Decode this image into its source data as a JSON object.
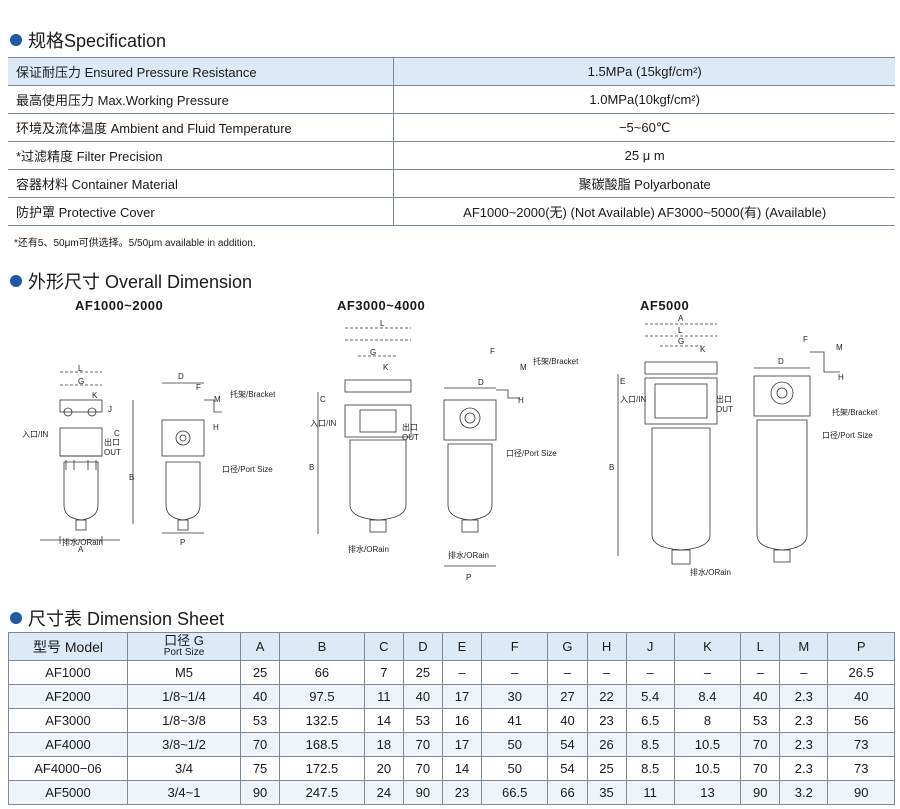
{
  "spec_section": {
    "title": "规格Specification",
    "rows": [
      {
        "label": "保证耐压力 Ensured Pressure Resistance",
        "value": "1.5MPa (15kgf/cm²)"
      },
      {
        "label": "最高使用压力 Max.Working Pressure",
        "value": "1.0MPa(10kgf/cm²)"
      },
      {
        "label": "环境及流体温度 Ambient and Fluid Temperature",
        "value": "−5~60℃"
      },
      {
        "label": "*过滤精度 Filter Precision",
        "value": "25 μ m"
      },
      {
        "label": "容器材料 Container Material",
        "value": "聚碳酸脂 Polyarbonate"
      },
      {
        "label": "防护罩 Protective Cover",
        "value": "AF1000~2000(无) (Not Available)  AF3000~5000(有) (Available)"
      }
    ],
    "note": "*还有5、50μm可供选择。5/50μm available in addition."
  },
  "dimension_section": {
    "title": "外形尺寸 Overall Dimension",
    "drawings": [
      {
        "label": "AF1000~2000"
      },
      {
        "label": "AF3000~4000"
      },
      {
        "label": "AF5000"
      }
    ],
    "callouts": {
      "inlet": "入口/IN",
      "outlet_cn": "出口",
      "outlet_en": "OUT",
      "bracket": "托架/Bracket",
      "port_size": "口径/Port Size",
      "drain": "排水/ORain"
    },
    "letters": {
      "A": "A",
      "B": "B",
      "C": "C",
      "D": "D",
      "E": "E",
      "F": "F",
      "G": "G",
      "H": "H",
      "J": "J",
      "K": "K",
      "L": "L",
      "M": "M",
      "P": "P"
    }
  },
  "sheet_section": {
    "title": "尺寸表 Dimension Sheet",
    "headers": {
      "model": "型号 Model",
      "port_cn": "口径 G",
      "port_en": "Port Size",
      "cols": [
        "A",
        "B",
        "C",
        "D",
        "E",
        "F",
        "G",
        "H",
        "J",
        "K",
        "L",
        "M",
        "P"
      ]
    },
    "rows": [
      [
        "AF1000",
        "M5",
        "25",
        "66",
        "7",
        "25",
        "–",
        "–",
        "–",
        "–",
        "–",
        "–",
        "–",
        "–",
        "26.5"
      ],
      [
        "AF2000",
        "1/8~1/4",
        "40",
        "97.5",
        "11",
        "40",
        "17",
        "30",
        "27",
        "22",
        "5.4",
        "8.4",
        "40",
        "2.3",
        "40"
      ],
      [
        "AF3000",
        "1/8~3/8",
        "53",
        "132.5",
        "14",
        "53",
        "16",
        "41",
        "40",
        "23",
        "6.5",
        "8",
        "53",
        "2.3",
        "56"
      ],
      [
        "AF4000",
        "3/8~1/2",
        "70",
        "168.5",
        "18",
        "70",
        "17",
        "50",
        "54",
        "26",
        "8.5",
        "10.5",
        "70",
        "2.3",
        "73"
      ],
      [
        "AF4000−06",
        "3/4",
        "75",
        "172.5",
        "20",
        "70",
        "14",
        "50",
        "54",
        "25",
        "8.5",
        "10.5",
        "70",
        "2.3",
        "73"
      ],
      [
        "AF5000",
        "3/4~1",
        "90",
        "247.5",
        "24",
        "90",
        "23",
        "66.5",
        "66",
        "35",
        "11",
        "13",
        "90",
        "3.2",
        "90"
      ]
    ]
  },
  "colors": {
    "accent": "#1f5aa6",
    "shade": "#dbeaf6",
    "rule": "#7a8a99"
  }
}
